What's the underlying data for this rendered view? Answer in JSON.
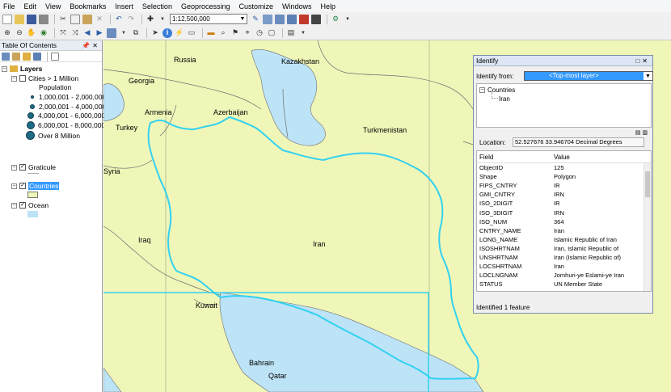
{
  "menu": [
    "File",
    "Edit",
    "View",
    "Bookmarks",
    "Insert",
    "Selection",
    "Geoprocessing",
    "Customize",
    "Windows",
    "Help"
  ],
  "scale": "1:12,500,000",
  "toc": {
    "title": "Table Of Contents",
    "layers_root": "Layers",
    "cities_layer": "Cities > 1 Million",
    "population_heading": "Population",
    "legend": [
      {
        "label": "1,000,001 - 2,000,000"
      },
      {
        "label": "2,000,001 - 4,000,000"
      },
      {
        "label": "4,000,001 - 6,000,000"
      },
      {
        "label": "6,000,001 - 8,000,000"
      },
      {
        "label": "Over 8 Million"
      }
    ],
    "graticule_layer": "Graticule",
    "countries_layer": "Countries",
    "ocean_layer": "Ocean"
  },
  "map": {
    "labels": {
      "russia": "Russia",
      "kazakhstan": "Kazakhstan",
      "georgia": "Georgia",
      "armenia": "Armenia",
      "azerbaijan": "Azerbaijan",
      "turkey": "Turkey",
      "turkmenistan": "Turkmenistan",
      "syria": "Syria",
      "iraq": "Iraq",
      "iran": "Iran",
      "kuwait": "Kuwait",
      "bahrain": "Bahrain",
      "qatar": "Qatar"
    },
    "colors": {
      "land": "#f0f6b8",
      "ocean": "#bde3f7",
      "highlight": "#33d1f0",
      "border": "#6e6e6e"
    }
  },
  "identify": {
    "title": "Identify",
    "from_label": "Identify from:",
    "from_value": "<Top-most layer>",
    "tree_root": "Countries",
    "tree_child": "Iran",
    "location_label": "Location:",
    "location_value": "52.527676  33.946704 Decimal Degrees",
    "col_field": "Field",
    "col_value": "Value",
    "rows": [
      {
        "field": "ObjectID",
        "value": "125"
      },
      {
        "field": "Shape",
        "value": "Polygon"
      },
      {
        "field": "FIPS_CNTRY",
        "value": "IR"
      },
      {
        "field": "GMI_CNTRY",
        "value": "IRN"
      },
      {
        "field": "ISO_2DIGIT",
        "value": "IR"
      },
      {
        "field": "ISO_3DIGIT",
        "value": "IRN"
      },
      {
        "field": "ISO_NUM",
        "value": "364"
      },
      {
        "field": "CNTRY_NAME",
        "value": "Iran"
      },
      {
        "field": "LONG_NAME",
        "value": "Islamic Republic of Iran"
      },
      {
        "field": "ISOSHRTNAM",
        "value": "Iran, Islamic Republic of"
      },
      {
        "field": "UNSHRTNAM",
        "value": "Iran (Islamic Republic of)"
      },
      {
        "field": "LOCSHRTNAM",
        "value": "Iran"
      },
      {
        "field": "LOCLNGNAM",
        "value": "Jomhuri-ye Eslami-ye Iran"
      },
      {
        "field": "STATUS",
        "value": "UN Member State"
      }
    ],
    "status": "Identified 1 feature"
  }
}
